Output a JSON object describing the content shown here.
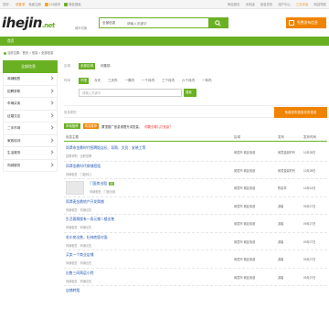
{
  "topbar": {
    "welcome": "您好，",
    "login": "请登录",
    "register": "免费注册",
    "links": [
      "113城市",
      "微信搜索"
    ],
    "right_links": [
      "网站首页",
      "手机版",
      "信息发布",
      "用户中心",
      "三元平台",
      "网站导航"
    ]
  },
  "logo": {
    "main": "ihejin",
    "net": ".net"
  },
  "city": "城市切换",
  "search": {
    "category": "全部信息",
    "placeholder": "请输入关键字"
  },
  "post_button": "免费发布信息",
  "nav": {
    "home": "首页"
  },
  "breadcrumb": "当前位置：首页 > 信息 > 全部信息",
  "sidebar": {
    "title": "全部信息",
    "items": [
      "商铺租售",
      "招聘求职",
      "车辆买卖",
      "征婚交友",
      "二手市场",
      "家政培训",
      "生活服务",
      "同城服务"
    ]
  },
  "filters": {
    "area_label": "区域",
    "area_options": [
      "全部区域",
      "闵集镇"
    ],
    "time_label": "时间",
    "time_options": [
      "不限",
      "今天",
      "三天内",
      "一周内",
      "一个月内",
      "三个月内",
      "六个月内",
      "一年内"
    ]
  },
  "keyword": {
    "placeholder": "请输入关键字",
    "button": "搜索"
  },
  "cats": {
    "label": "信息类别",
    "button": "免费发布信息发布信息"
  },
  "tags": {
    "green": "本地推荐",
    "orange": "精选推荐",
    "text": "置顶推广信息请提升浏览量，",
    "red": "你要去哪儿打信息？"
  },
  "table_head": {
    "title": "信息主题",
    "area": "区域",
    "publisher": "发布",
    "time": "发布时间"
  },
  "rows": [
    {
      "title": "闵潭市金鼎时代招聘饭店长、导购、文员、安装工等",
      "sub": "招聘求职 · 全职招聘",
      "area": "闵潭市·城区街道",
      "pub": "闵潭金鼎时代",
      "time": "10月28日"
    },
    {
      "title": "闵潭金鼎时代商铺招租",
      "sub": "商铺租售 · 门面转让",
      "area": "闵潭市·城区街道",
      "pub": "闵潭金鼎时代",
      "time": "10月28日"
    },
    {
      "title": "门面房出租",
      "sub": "商铺租售 · 门面出租",
      "area": "闵潭市·城区街道",
      "pub": "陈启章",
      "time": "10月14日",
      "badge": "图"
    },
    {
      "title": "闵潭麦金鼎地产开发属铺",
      "sub": "商铺租售 · 商铺出售",
      "area": "闵潭市·城区街道",
      "pub": "游客",
      "time": "09月27日"
    },
    {
      "title": "生活客属楼有一寿元铺二楼出售",
      "sub": "商铺租售 · 商铺出售",
      "area": "闵潭市·城区街道",
      "pub": "游客",
      "time": "09月27日"
    },
    {
      "title": "毛巾房出售，杜林底版对面",
      "sub": "商铺租售 · 商铺出售",
      "area": "闵潭市·城区街道",
      "pub": "游客",
      "time": "09月27日"
    },
    {
      "title": "买卖一个商业店铺",
      "sub": "商铺租售 · 商铺出售",
      "area": "闵潭市·城区街道",
      "pub": "游客",
      "time": "09月27日"
    },
    {
      "title": "出售三间两层小院",
      "sub": "商铺租售 · 商铺出售",
      "area": "闵潭市·城区街道",
      "pub": "游客",
      "time": "09月27日"
    },
    {
      "title": "店铺转租",
      "sub": "",
      "area": "",
      "pub": "",
      "time": ""
    }
  ]
}
